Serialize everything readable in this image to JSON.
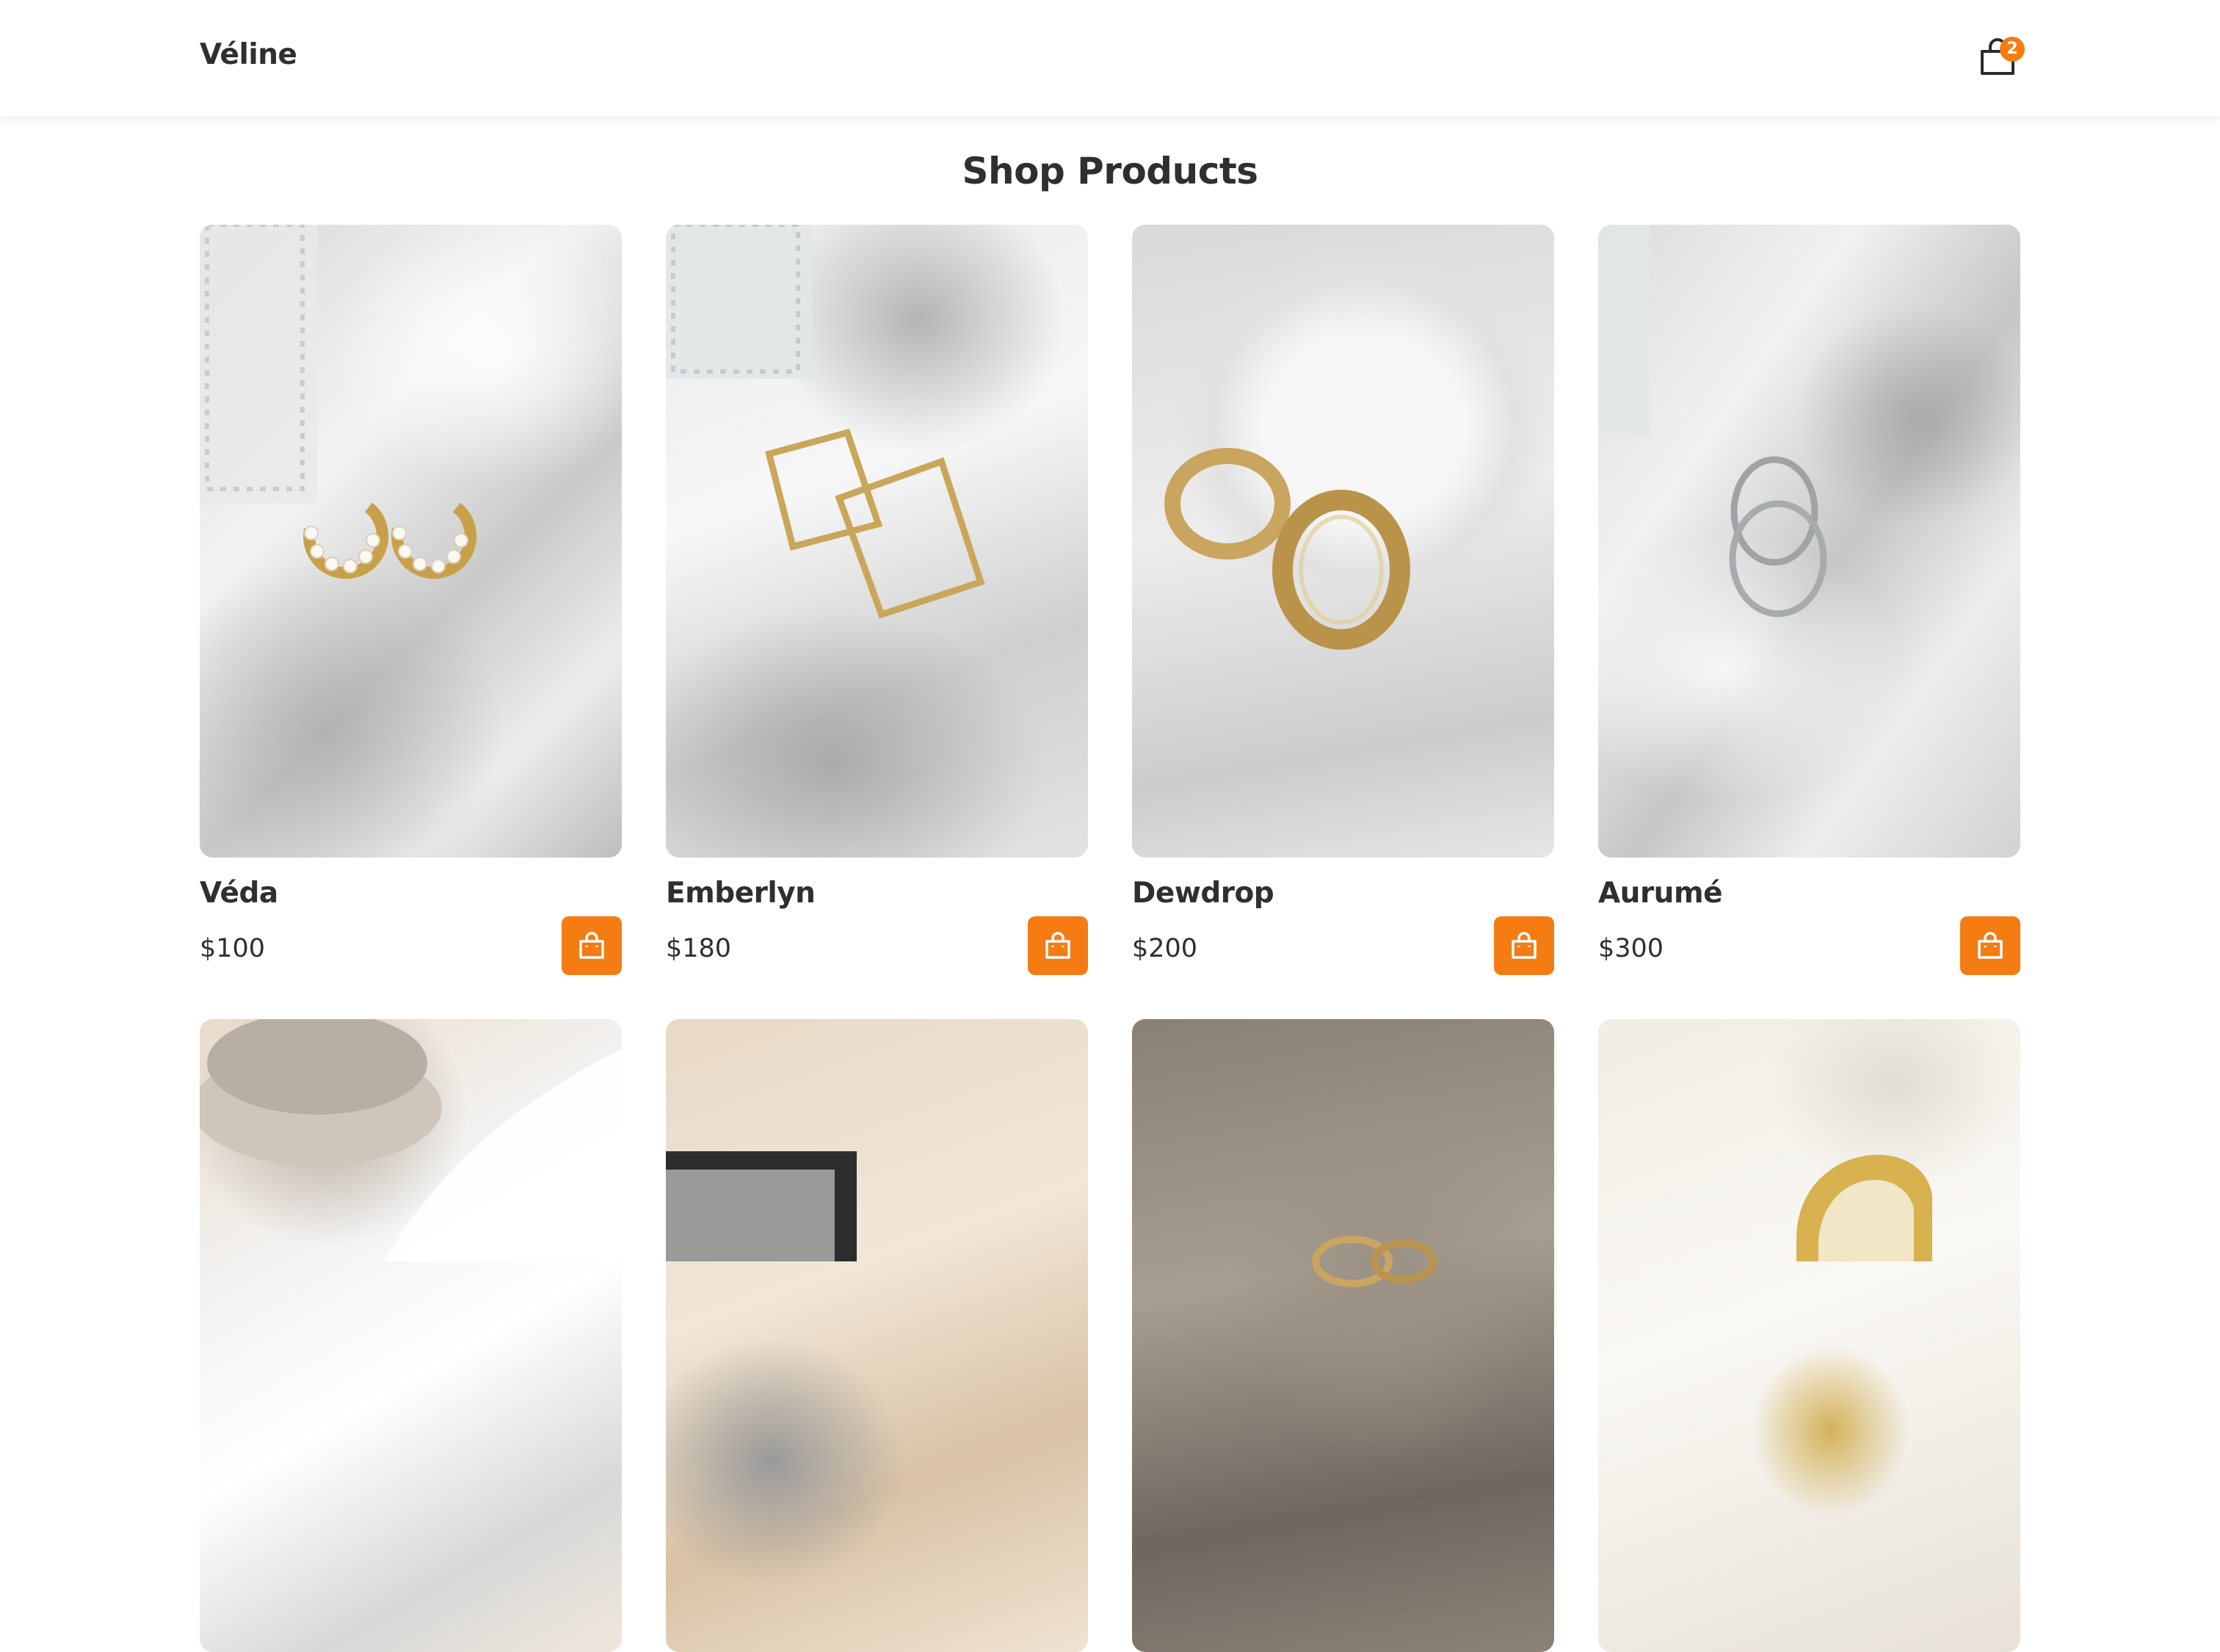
{
  "header": {
    "brand": "Véline",
    "cart_count": "2"
  },
  "page_title": "Shop Products",
  "products": [
    {
      "name": "Véda",
      "price": "$100",
      "image_icon": "pearl-hoop-earrings-image"
    },
    {
      "name": "Emberlyn",
      "price": "$180",
      "image_icon": "square-hoop-earrings-image"
    },
    {
      "name": "Dewdrop",
      "price": "$200",
      "image_icon": "gold-hoop-earrings-image"
    },
    {
      "name": "Aurumé",
      "price": "$300",
      "image_icon": "silver-hoop-earrings-image"
    },
    {
      "image_icon": "ceramic-bowl-cloth-image"
    },
    {
      "image_icon": "stone-tray-image"
    },
    {
      "image_icon": "gold-hoops-on-stone-image"
    },
    {
      "image_icon": "gold-cuff-ring-image"
    }
  ],
  "colors": {
    "accent": "#f57c12",
    "text": "#2f2f2f",
    "background": "#ffffff"
  }
}
